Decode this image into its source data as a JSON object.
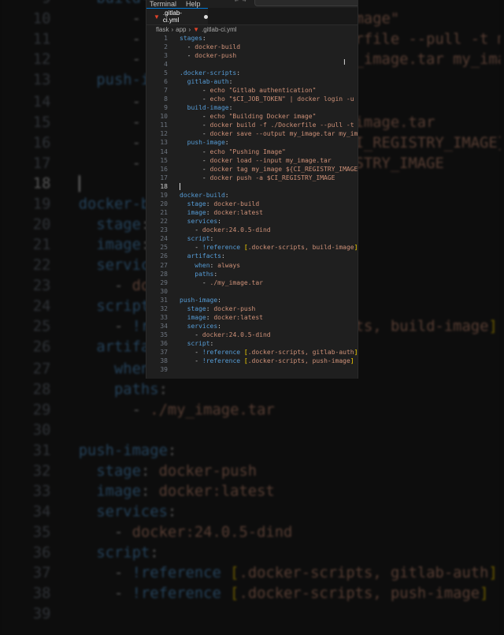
{
  "menu": [
    "Terminal",
    "Help"
  ],
  "tab": {
    "icon": "gitlab-icon",
    "label": ".gitlab-ci.yml",
    "modified": true
  },
  "breadcrumb": [
    "flask",
    "app",
    ".gitlab-ci.yml"
  ],
  "current_line": 18,
  "colors": {
    "key": "#569cd6",
    "value": "#ce9178",
    "bracket": "#ffd700",
    "background": "#1f1f1f"
  },
  "code": [
    [
      [
        "stages",
        "k"
      ],
      [
        ":",
        "p"
      ]
    ],
    [
      [
        "  - ",
        "p"
      ],
      [
        "docker-build",
        "s"
      ]
    ],
    [
      [
        "  - ",
        "p"
      ],
      [
        "docker-push",
        "s"
      ]
    ],
    [],
    [
      [
        ".docker-scripts",
        "k"
      ],
      [
        ":",
        "p"
      ]
    ],
    [
      [
        "  gitlab-auth",
        "k"
      ],
      [
        ":",
        "p"
      ]
    ],
    [
      [
        "      - ",
        "p"
      ],
      [
        "echo \"Gitlab authentication\"",
        "s"
      ]
    ],
    [
      [
        "      - ",
        "p"
      ],
      [
        "echo \"$CI_JOB_TOKEN\" | docker login -u gitlab-ci-token --password-stdin $CI_REGISTRY",
        "s"
      ]
    ],
    [
      [
        "  build-image",
        "k"
      ],
      [
        ":",
        "p"
      ]
    ],
    [
      [
        "      - ",
        "p"
      ],
      [
        "echo \"Building Docker image\"",
        "s"
      ]
    ],
    [
      [
        "      - ",
        "p"
      ],
      [
        "docker build -f ./Dockerfile --pull -t my_image .",
        "s"
      ]
    ],
    [
      [
        "      - ",
        "p"
      ],
      [
        "docker save --output my_image.tar my_image",
        "s"
      ]
    ],
    [
      [
        "  push-image",
        "k"
      ],
      [
        ":",
        "p"
      ]
    ],
    [
      [
        "      - ",
        "p"
      ],
      [
        "echo \"Pushing Image\"",
        "s"
      ]
    ],
    [
      [
        "      - ",
        "p"
      ],
      [
        "docker load --input my_image.tar",
        "s"
      ]
    ],
    [
      [
        "      - ",
        "p"
      ],
      [
        "docker tag my_image ${CI_REGISTRY_IMAGE}:${CI_COMMIT_SHA}",
        "s"
      ]
    ],
    [
      [
        "      - ",
        "p"
      ],
      [
        "docker push -a $CI_REGISTRY_IMAGE",
        "s"
      ]
    ],
    [],
    [
      [
        "docker-build",
        "k"
      ],
      [
        ":",
        "p"
      ]
    ],
    [
      [
        "  stage",
        "k"
      ],
      [
        ": ",
        "p"
      ],
      [
        "docker-build",
        "s"
      ]
    ],
    [
      [
        "  image",
        "k"
      ],
      [
        ": ",
        "p"
      ],
      [
        "docker:latest",
        "s"
      ]
    ],
    [
      [
        "  services",
        "k"
      ],
      [
        ":",
        "p"
      ]
    ],
    [
      [
        "    - ",
        "p"
      ],
      [
        "docker:24.0.5-dind",
        "s"
      ]
    ],
    [
      [
        "  script",
        "k"
      ],
      [
        ":",
        "p"
      ]
    ],
    [
      [
        "    - ",
        "p"
      ],
      [
        "!reference",
        "t"
      ],
      [
        " ",
        "p"
      ],
      [
        "[",
        "b"
      ],
      [
        ".docker-scripts, build-image",
        "s"
      ],
      [
        "]",
        "b"
      ]
    ],
    [
      [
        "  artifacts",
        "k"
      ],
      [
        ":",
        "p"
      ]
    ],
    [
      [
        "    when",
        "k"
      ],
      [
        ": ",
        "p"
      ],
      [
        "always",
        "s"
      ]
    ],
    [
      [
        "    paths",
        "k"
      ],
      [
        ":",
        "p"
      ]
    ],
    [
      [
        "      - ",
        "p"
      ],
      [
        "./my_image.tar",
        "s"
      ]
    ],
    [],
    [
      [
        "push-image",
        "k"
      ],
      [
        ":",
        "p"
      ]
    ],
    [
      [
        "  stage",
        "k"
      ],
      [
        ": ",
        "p"
      ],
      [
        "docker-push",
        "s"
      ]
    ],
    [
      [
        "  image",
        "k"
      ],
      [
        ": ",
        "p"
      ],
      [
        "docker:latest",
        "s"
      ]
    ],
    [
      [
        "  services",
        "k"
      ],
      [
        ":",
        "p"
      ]
    ],
    [
      [
        "    - ",
        "p"
      ],
      [
        "docker:24.0.5-dind",
        "s"
      ]
    ],
    [
      [
        "  script",
        "k"
      ],
      [
        ":",
        "p"
      ]
    ],
    [
      [
        "    - ",
        "p"
      ],
      [
        "!reference",
        "t"
      ],
      [
        " ",
        "p"
      ],
      [
        "[",
        "b"
      ],
      [
        ".docker-scripts, gitlab-auth",
        "s"
      ],
      [
        "]",
        "b"
      ]
    ],
    [
      [
        "    - ",
        "p"
      ],
      [
        "!reference",
        "t"
      ],
      [
        " ",
        "p"
      ],
      [
        "[",
        "b"
      ],
      [
        ".docker-scripts, push-image",
        "s"
      ],
      [
        "]",
        "b"
      ]
    ],
    []
  ]
}
